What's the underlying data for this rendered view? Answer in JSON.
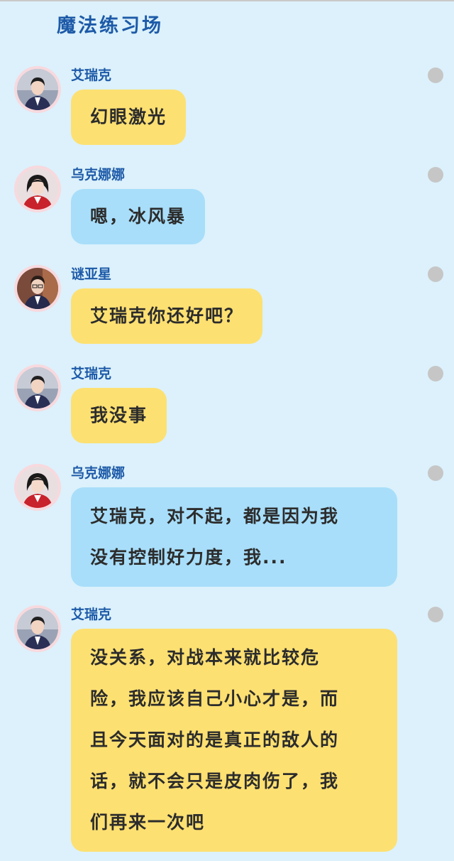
{
  "header": {
    "title": "魔法练习场"
  },
  "colors": {
    "background": "#dcf1fb",
    "title": "#1d5aa8",
    "bubble_yellow": "#fde072",
    "bubble_blue": "#a8defa",
    "status_dot": "#c6c6c6"
  },
  "messages": [
    {
      "sender": "艾瑞克",
      "text": "幻眼激光",
      "bubble_color": "yellow",
      "avatar_icon": "avatar-eric-icon"
    },
    {
      "sender": "乌克娜娜",
      "text": "嗯，冰风暴",
      "bubble_color": "blue",
      "avatar_icon": "avatar-ukenana-icon"
    },
    {
      "sender": "谜亚星",
      "text": "艾瑞克你还好吧？",
      "bubble_color": "yellow",
      "avatar_icon": "avatar-miyaxing-icon"
    },
    {
      "sender": "艾瑞克",
      "text": "我没事",
      "bubble_color": "yellow",
      "avatar_icon": "avatar-eric-icon"
    },
    {
      "sender": "乌克娜娜",
      "text": "艾瑞克，对不起，都是因为我\n没有控制好力度，我...",
      "bubble_color": "blue",
      "avatar_icon": "avatar-ukenana-icon"
    },
    {
      "sender": "艾瑞克",
      "text": "没关系，对战本来就比较危\n险，我应该自己小心才是，而\n且今天面对的是真正的敌人的\n话，就不会只是皮肉伤了，我\n们再来一次吧",
      "bubble_color": "yellow",
      "avatar_icon": "avatar-eric-icon"
    }
  ]
}
